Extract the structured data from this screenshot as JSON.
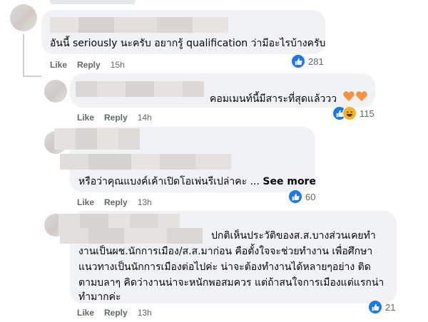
{
  "comments": [
    {
      "text_lines": [
        "อันนี้ seriously นะครับ อยากรู้ qualification ว่ามีอะไรบ้างครับ"
      ],
      "like_label": "Like",
      "reply_label": "Reply",
      "time": "15h",
      "reaction_icon": "like-icon",
      "reaction_count": "281"
    },
    {
      "text_lines": [
        "คอมเมนท์นี้มีสาระที่สุดแล้ววว"
      ],
      "emoji": "🧡🧡",
      "like_label": "Like",
      "reply_label": "Reply",
      "time": "14h",
      "reaction_icons": [
        "like-icon",
        "haha-icon"
      ],
      "reaction_count": "115"
    },
    {
      "text_lines": [
        "หรือว่าคุณแบงค์เค้าเปิดโอเพ่นรีเปล่าคะ ..."
      ],
      "see_more": "See more",
      "like_label": "Like",
      "reply_label": "Reply",
      "time": "13h",
      "reaction_icon": "like-icon",
      "reaction_count": "60"
    },
    {
      "text_lines": [
        "ปกติเห็นประวัติของส.ส.บางส่วนเคยทำ",
        "งานเป็นผช.นักการเมือง/ส.ส.มาก่อน คือตั้งใจจะช่วยทำงาน เพื่อศึกษา",
        "แนวทางเป็นนักการเมืองต่อไปค่ะ น่าจะต้องทำงานได้หลายๆอย่าง ติด",
        "ตามบลาๆ คิดว่างานน่าจะหนักพอสมควร แต่ถ้าสนใจการเมืองแต่แรกน่า",
        "ทำมากค่ะ"
      ],
      "like_label": "Like",
      "reply_label": "Reply",
      "time": "13h",
      "reaction_icon": "like-icon",
      "reaction_count": "21"
    }
  ],
  "colors": {
    "bubble": "#f0f2f5",
    "meta_text": "#65676b",
    "like_blue": "#1877f2",
    "haha_yellow": "#f7b125",
    "heart_orange": "#f7923b"
  }
}
